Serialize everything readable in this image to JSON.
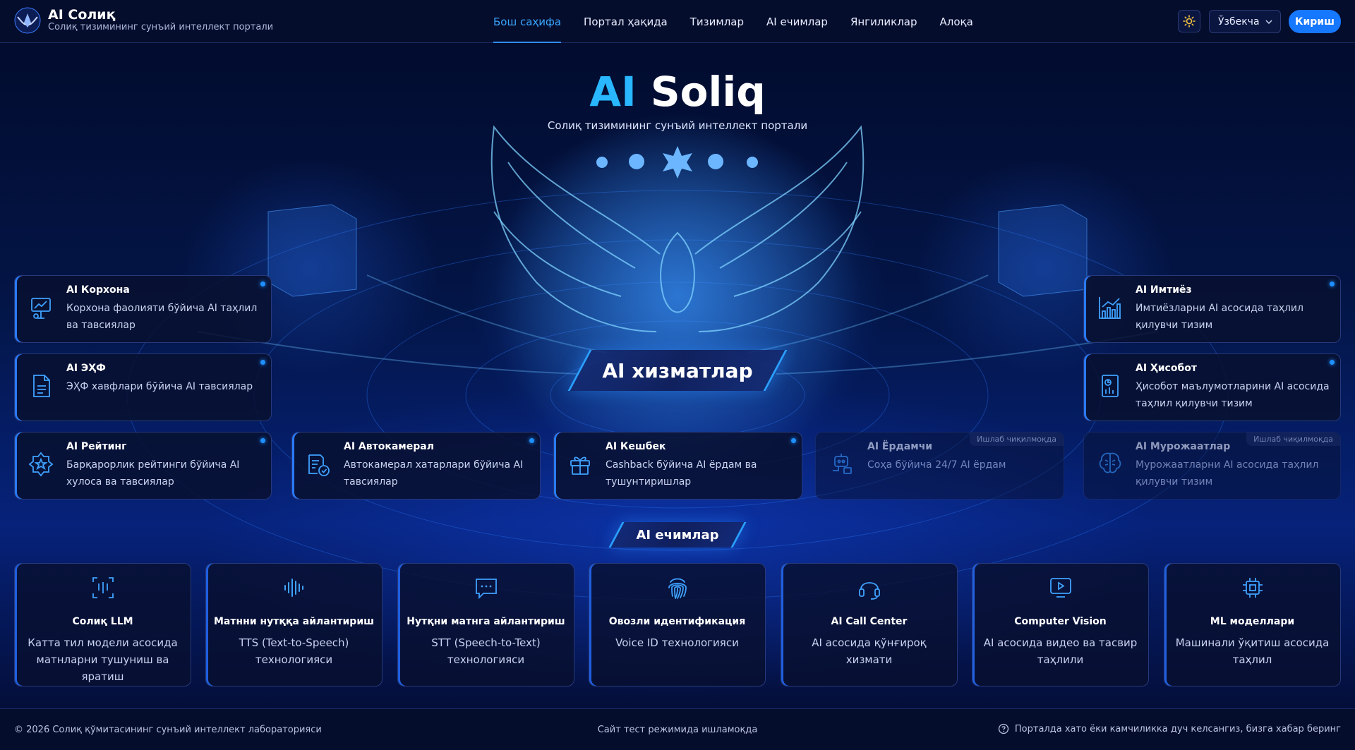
{
  "header": {
    "brand_title": "AI Солиқ",
    "brand_subtitle": "Солиқ тизимининг сунъий интеллект портали",
    "nav": [
      {
        "label": "Бош саҳифа",
        "active": true
      },
      {
        "label": "Портал ҳақида"
      },
      {
        "label": "Тизимлар"
      },
      {
        "label": "AI ечимлар"
      },
      {
        "label": "Янгиликлар"
      },
      {
        "label": "Алоқа"
      }
    ],
    "theme_icon": "sun-icon",
    "language": "Ўзбекча",
    "login_label": "Кириш"
  },
  "hero": {
    "title_accent": "AI",
    "title_rest": "Soliq",
    "subtitle": "Солиқ тизимининг сунъий интеллект портали"
  },
  "services_section": {
    "title": "AI хизматлар",
    "cards": [
      {
        "title": "AI Корхона",
        "desc": "Корхона фаолияти бўйича AI таҳлил ва тавсиялар",
        "icon": "presentation-chart-icon"
      },
      {
        "title": "AI ЭҲФ",
        "desc": "ЭҲФ хавфлари бўйича AI тавсиялар",
        "icon": "document-icon"
      },
      {
        "title": "AI Рейтинг",
        "desc": "Барқарорлик рейтинги бўйича AI хулоса ва тавсиялар",
        "icon": "star-badge-icon"
      },
      {
        "title": "AI Автокамерал",
        "desc": "Автокамерал хатарлари бўйича AI тавсиялар",
        "icon": "document-check-icon"
      },
      {
        "title": "AI Кешбек",
        "desc": "Cashback бўйича AI ёрдам ва тушунтиришлар",
        "icon": "gift-icon"
      },
      {
        "title": "AI Ёрдамчи",
        "desc": "Соҳа бўйича 24/7 AI ёрдам",
        "icon": "robot-icon",
        "badge": "Ишлаб чиқилмоқда"
      },
      {
        "title": "AI Мурожаатлар",
        "desc": "Мурожаатларни AI асосида таҳлил қилувчи тизим",
        "icon": "brain-icon",
        "badge": "Ишлаб чиқилмоқда"
      },
      {
        "title": "AI Имтиёз",
        "desc": "Имтиёзларни AI асосида таҳлил қилувчи тизим",
        "icon": "bar-chart-icon"
      },
      {
        "title": "AI Ҳисобот",
        "desc": "Ҳисобот маълумотларини AI асосида таҳлил қилувчи тизим",
        "icon": "report-icon"
      }
    ]
  },
  "solutions_section": {
    "title": "AI ечимлар",
    "cards": [
      {
        "title": "Солиқ LLM",
        "desc": "Катта тил модели асосида матнларни тушуниш ва яратиш",
        "icon": "llm-icon"
      },
      {
        "title": "Матнни нутққа айлантириш",
        "desc": "TTS (Text-to-Speech) технологияси",
        "icon": "audio-wave-icon"
      },
      {
        "title": "Нутқни матнга айлантириш",
        "desc": "STT (Speech-to-Text) технологияси",
        "icon": "message-icon"
      },
      {
        "title": "Овозли идентификация",
        "desc": "Voice ID технологияси",
        "icon": "fingerprint-icon"
      },
      {
        "title": "AI Call Center",
        "desc": "AI асосида қўнғироқ хизмати",
        "icon": "headset-icon"
      },
      {
        "title": "Computer Vision",
        "desc": "AI асосида видео ва тасвир таҳлили",
        "icon": "play-screen-icon"
      },
      {
        "title": "ML моделлари",
        "desc": "Машинали ўқитиш асосида таҳлил",
        "icon": "cpu-icon"
      }
    ]
  },
  "footer": {
    "copyright": "© 2026 Солиқ қўмитасининг сунъий интеллект лабораторияси",
    "center": "Сайт тест режимида ишламоқда",
    "report": "Порталда хато ёки камчиликка дуч келсангиз, бизга хабар беринг"
  },
  "colors": {
    "accent": "#29b7ff",
    "primary": "#1677ff",
    "background": "#030a2a",
    "active_dot": "#1e90ff"
  }
}
